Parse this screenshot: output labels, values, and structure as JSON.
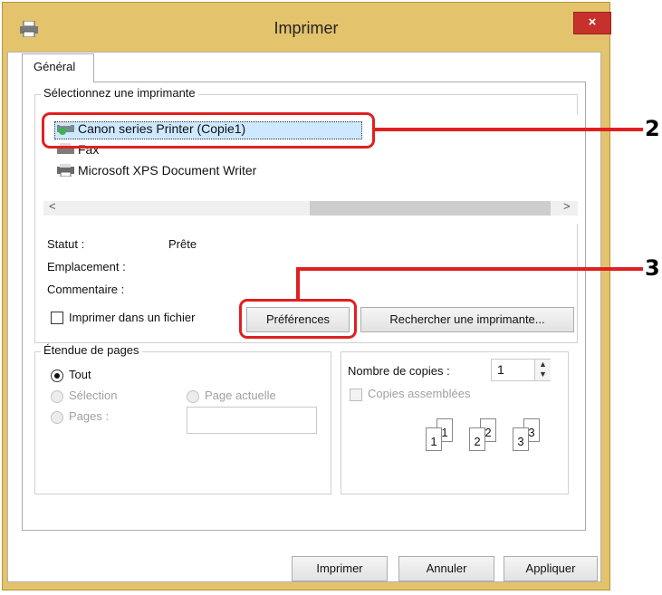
{
  "window": {
    "title": "Imprimer",
    "close_label": "×"
  },
  "tabs": [
    {
      "label": "Général"
    }
  ],
  "select_printer": {
    "group_label": "Sélectionnez une imprimante",
    "printers": [
      {
        "name": "Canon        series Printer (Copie1)",
        "selected": true,
        "icon": "printer-check-icon"
      },
      {
        "name": "Fax",
        "icon": "fax-icon"
      },
      {
        "name": "Microsoft XPS Document Writer",
        "icon": "printer-icon"
      }
    ],
    "scroll_left": "<",
    "scroll_right": ">",
    "status_label": "Statut :",
    "status_value": "Prête",
    "location_label": "Emplacement :",
    "comment_label": "Commentaire :",
    "print_to_file_label": "Imprimer dans un fichier",
    "preferences_button": "Préférences",
    "find_printer_button": "Rechercher une imprimante..."
  },
  "page_range": {
    "group_label": "Étendue de pages",
    "all_label": "Tout",
    "selection_label": "Sélection",
    "current_page_label": "Page actuelle",
    "pages_label": "Pages :"
  },
  "copies": {
    "count_label": "Nombre de copies :",
    "count_value": "1",
    "collate_label": "Copies assemblées",
    "collate_pages": [
      "1",
      "1",
      "2",
      "2",
      "3",
      "3"
    ]
  },
  "footer": {
    "print_button": "Imprimer",
    "cancel_button": "Annuler",
    "apply_button": "Appliquer"
  },
  "callouts": {
    "printer": "2",
    "preferences": "3"
  },
  "colors": {
    "accent_title": "#e3c36c",
    "close": "#c7312b",
    "highlight": "#e02020"
  }
}
